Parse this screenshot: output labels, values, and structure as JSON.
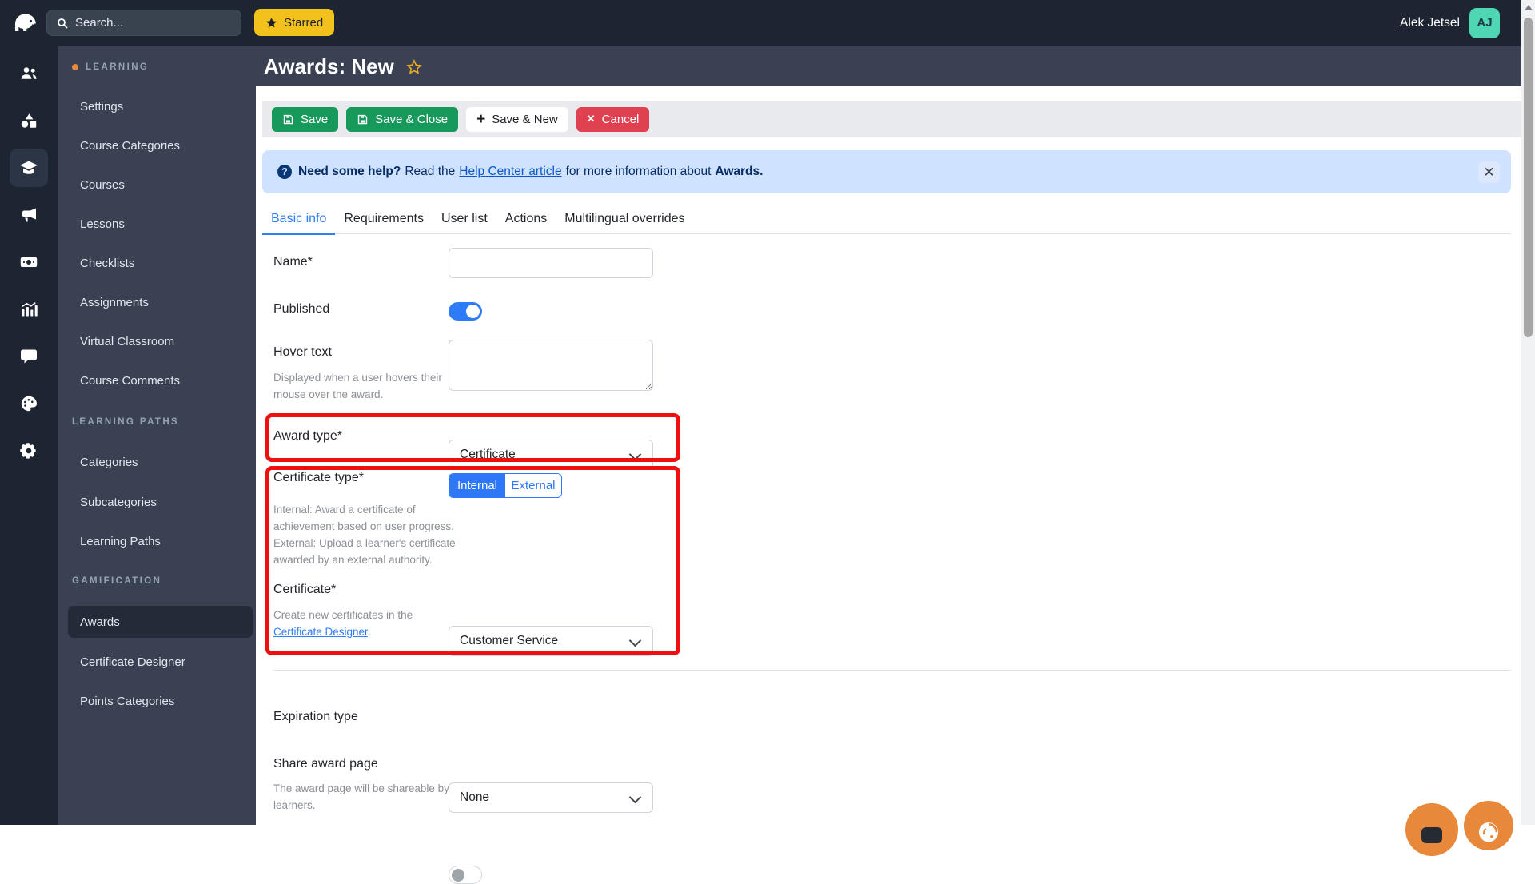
{
  "colors": {
    "topbar_bg": "#1e2532",
    "sidebar_bg": "#394153",
    "accent_blue": "#2e7bf7",
    "success_green": "#18995c",
    "danger_red": "#df4150",
    "star_yellow": "#f3c11b",
    "avatar_teal": "#4fd6b2",
    "brand_orange": "#e8883a",
    "annotation_red": "#ee1010",
    "banner_bg": "#cfe2ff",
    "banner_text": "#052c65"
  },
  "topbar": {
    "search_placeholder": "Search...",
    "starred_label": "Starred",
    "user_name": "Alek Jetsel",
    "user_initials": "AJ"
  },
  "rail": {
    "icons": [
      "users",
      "shapes",
      "graduation-cap",
      "megaphone",
      "banknote",
      "analytics",
      "chat",
      "palette",
      "gear"
    ],
    "active_icon": "graduation-cap"
  },
  "sidebar": {
    "sections": [
      {
        "label": "LEARNING",
        "items": [
          "Settings",
          "Course Categories",
          "Courses",
          "Lessons",
          "Checklists",
          "Assignments",
          "Virtual Classroom",
          "Course Comments"
        ]
      },
      {
        "label": "LEARNING PATHS",
        "items": [
          "Categories",
          "Subcategories",
          "Learning Paths"
        ]
      },
      {
        "label": "GAMIFICATION",
        "items": [
          "Awards",
          "Certificate Designer",
          "Points Categories"
        ]
      }
    ],
    "active_item": "Awards"
  },
  "page": {
    "title": "Awards: New"
  },
  "toolbar": {
    "save": "Save",
    "save_and_close": "Save & Close",
    "save_and_new": "Save & New",
    "cancel": "Cancel"
  },
  "banner": {
    "lead_bold": "Need some help?",
    "before_link": "Read the",
    "link": "Help Center article",
    "after_link": "for more information about",
    "subject_bold": "Awards."
  },
  "tabs": {
    "items": [
      "Basic info",
      "Requirements",
      "User list",
      "Actions",
      "Multilingual overrides"
    ],
    "active": "Basic info"
  },
  "form": {
    "name": {
      "label": "Name*",
      "value": ""
    },
    "published": {
      "label": "Published",
      "state": "on"
    },
    "hover_text": {
      "label": "Hover text",
      "value": "",
      "help": "Displayed when a user hovers their mouse over the award."
    },
    "award_type": {
      "label": "Award type*",
      "value": "Certificate"
    },
    "certificate_type": {
      "label": "Certificate type*",
      "options": [
        "Internal",
        "External"
      ],
      "selected": "Internal",
      "help": "Internal: Award a certificate of achievement based on user progress. External: Upload a learner's certificate awarded by an external authority."
    },
    "certificate": {
      "label": "Certificate*",
      "value": "Customer Service",
      "help_before_link": "Create new certificates in the",
      "help_link": "Certificate Designer",
      "help_after_link": "."
    },
    "expiration_type": {
      "label": "Expiration type",
      "value": "None"
    },
    "share_award_page": {
      "label": "Share award page",
      "state": "off",
      "help": "The award page will be shareable by learners."
    }
  }
}
